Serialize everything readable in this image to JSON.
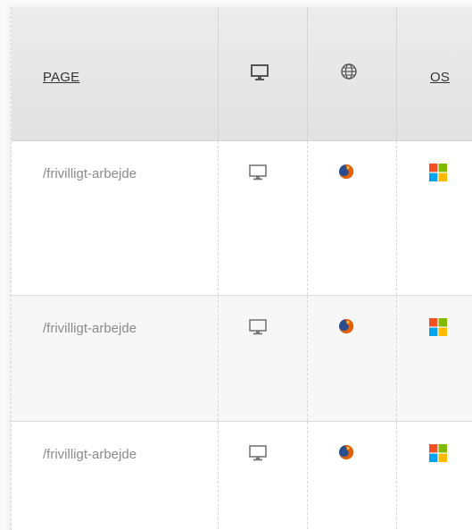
{
  "columns": {
    "page": "PAGE",
    "device_icon": "monitor-icon",
    "browser_icon": "globe-icon",
    "os": "OS"
  },
  "rows": [
    {
      "page": "/frivilligt-arbejde",
      "device": "desktop",
      "browser": "firefox",
      "os": "windows"
    },
    {
      "page": "/frivilligt-arbejde",
      "device": "desktop",
      "browser": "firefox",
      "os": "windows"
    },
    {
      "page": "/frivilligt-arbejde",
      "device": "desktop",
      "browser": "firefox",
      "os": "windows"
    }
  ],
  "colors": {
    "header_bg": "#e6e6e6",
    "alt_row_bg": "#f7f7f7",
    "page_text": "#8a8a8a",
    "win_red": "#f25022",
    "win_green": "#7fba00",
    "win_blue": "#00a4ef",
    "win_yellow": "#ffb900"
  }
}
